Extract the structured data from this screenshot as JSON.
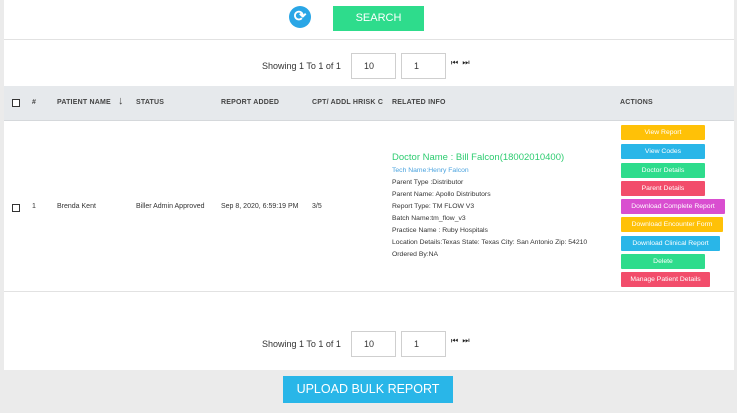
{
  "toolbar": {
    "refresh_icon": "refresh-icon",
    "search_label": "SEARCH"
  },
  "pagination_top": {
    "showing": "Showing 1 To 1 of 1",
    "page_size": "10",
    "page": "1",
    "nav": "⏮ ⏭"
  },
  "pagination_bottom": {
    "showing": "Showing 1 To 1 of 1",
    "page_size": "10",
    "page": "1",
    "nav": "⏮ ⏭"
  },
  "table": {
    "headers": {
      "num": "#",
      "patient": "PATIENT NAME",
      "sort": "↓",
      "status": "STATUS",
      "report_added": "REPORT ADDED",
      "cpt": "CPT/ ADDL HRISK C",
      "related": "RELATED INFO",
      "actions": "ACTIONS"
    },
    "rows": [
      {
        "num": "1",
        "patient": "Brenda Kent",
        "status": "Biller Admin Approved",
        "report_added": "Sep 8, 2020, 6:59:19 PM",
        "cpt": "3/5",
        "doctor": "Doctor Name : Bill Falcon(18002010400)",
        "tech": "Tech Name:Henry Falcon",
        "lines": [
          "Parent Type :Distributor",
          "Parent Name: Apollo Distributors",
          "Report Type: TM FLOW V3",
          "Batch Name:tm_flow_v3",
          "Practice Name : Ruby Hospitals",
          "Location Details:Texas State: Texas City: San Antonio Zip: 54210",
          "Ordered By:NA"
        ],
        "actions": [
          "View Report",
          "View Codes",
          "Doctor Details",
          "Parent Details",
          "Download Complete Report",
          "Download Encounter Form",
          "Download Clinical Report",
          "Delete",
          "Manage Patient Details"
        ]
      }
    ]
  },
  "upload_label": "UPLOAD BULK REPORT",
  "colors": {
    "search": "#2edc8c",
    "doctor_name": "#2ecc71",
    "tech_name": "#4aa3df",
    "view_report": "#ffc107",
    "view_codes": "#29b6e8",
    "doctor_details": "#2edc8c",
    "parent_details": "#f24d6b",
    "download_complete": "#d94ed0",
    "download_encounter": "#ffc107",
    "download_clinical": "#29b6e8",
    "delete": "#2edc8c",
    "manage_patient": "#f24d6b",
    "upload": "#29b6e8"
  }
}
